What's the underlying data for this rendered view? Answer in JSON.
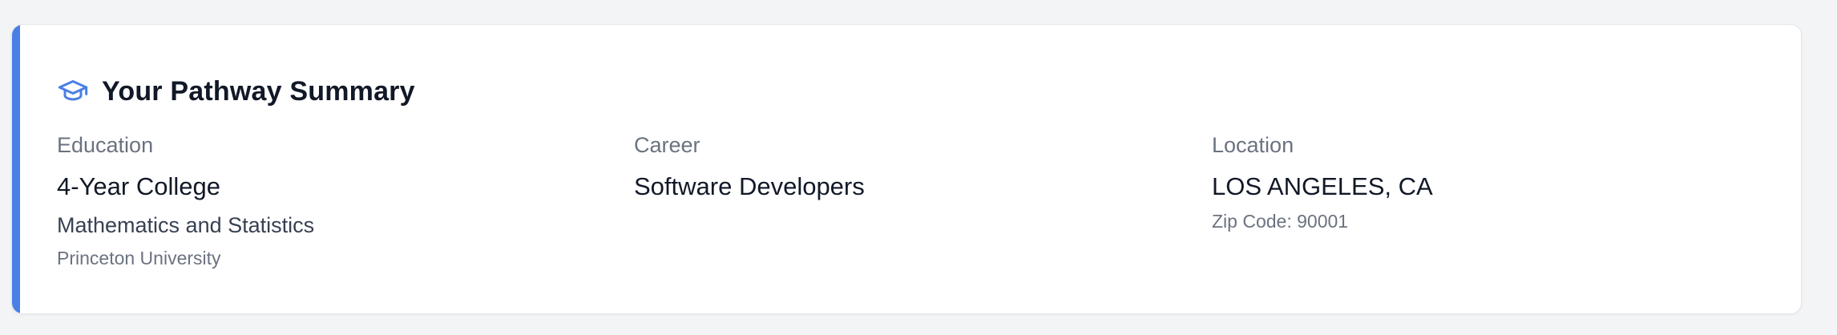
{
  "summary": {
    "title": "Your Pathway Summary",
    "icon": "graduation-cap-icon",
    "accent_color": "#4a7fe6"
  },
  "education": {
    "label": "Education",
    "type": "4-Year College",
    "major": "Mathematics and Statistics",
    "school": "Princeton University"
  },
  "career": {
    "label": "Career",
    "title": "Software Developers"
  },
  "location": {
    "label": "Location",
    "city": "LOS ANGELES, CA",
    "zip": "Zip Code: 90001"
  }
}
